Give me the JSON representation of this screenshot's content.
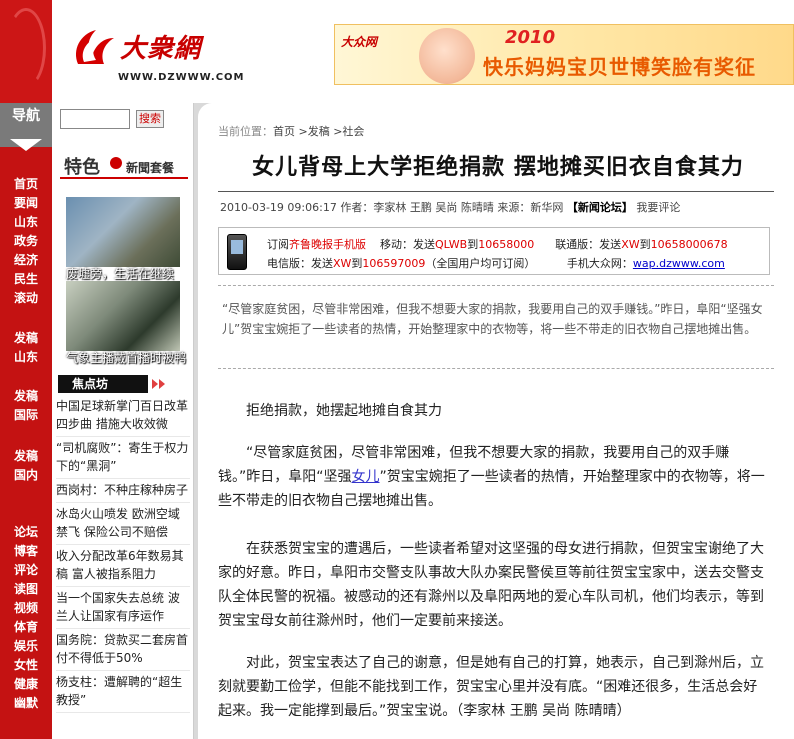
{
  "logo": {
    "name": "大衆網",
    "url": "WWW.DZWWW.COM"
  },
  "banner": {
    "logo": "大众网",
    "year": "2010",
    "slogan": "快乐妈妈宝贝世博笑脸有奖征"
  },
  "nav": {
    "header": "导航",
    "groups": [
      [
        "首页",
        "要闻",
        "山东",
        "政务",
        "经济",
        "民生",
        "滚动"
      ],
      [
        "发稿",
        "山东"
      ],
      [
        "发稿",
        "国际"
      ],
      [
        "发稿",
        "国内"
      ],
      [
        "论坛",
        "博客",
        "评论",
        "读图",
        "视频",
        "体育",
        "娱乐",
        "女性",
        "健康",
        "幽默"
      ]
    ]
  },
  "sidebar": {
    "search_button": "搜索",
    "tese": {
      "big": "特色",
      "small": "新聞套餐"
    },
    "captions": [
      "废墟旁，生活在继续",
      "气象主播戴首播时被鸭"
    ],
    "jiaodian_title": "焦点坊",
    "jiaodian": [
      "中国足球新掌门百日改革四步曲 措施大收效微",
      "“司机腐败”：寄生于权力下的“黑洞”",
      "西岗村：不种庄稼种房子",
      "冰岛火山喷发 欧洲空域禁飞 保险公司不赔偿",
      "收入分配改革6年数易其稿 富人被指系阻力",
      "当一个国家失去总统 波兰人让国家有序运作",
      "国务院：贷款买二套房首付不得低于50%",
      "杨支柱：遭解聘的“超生教授”"
    ]
  },
  "article": {
    "crumb_label": "当前位置：",
    "crumb_path": "首页 >发稿 >社会",
    "title": "女儿背母上大学拒绝捐款  摆地摊买旧衣自食其力",
    "meta_date": "2010-03-19 09:06:17",
    "meta_author": "作者：李家林 王鹏 吴尚 陈晴晴",
    "meta_source": "来源：新华网",
    "meta_forum": "【新闻论坛】",
    "meta_comment": "我要评论",
    "promo": {
      "line1_a": "订阅",
      "line1_b": "齐鲁晚报手机版",
      "line1_c": "移动：发送",
      "line1_d": "QLWB",
      "line1_e": "到",
      "line1_f": "10658000",
      "line1_g": "联通版：发送",
      "line1_h": "XW",
      "line1_i": "到",
      "line1_j": "10658000678",
      "line2_a": "电信版：发送",
      "line2_b": "XW",
      "line2_c": "到",
      "line2_d": "106597009",
      "line2_e": "（全国用户均可订阅）",
      "line2_f": "手机大众网：",
      "line2_g": "wap.dzwww.com"
    },
    "summary": "“尽管家庭贫困，尽管非常困难，但我不想要大家的捐款，我要用自己的双手赚钱。”昨日，阜阳“坚强女儿”贺宝宝婉拒了一些读者的热情，开始整理家中的衣物等，将一些不带走的旧衣物自己摆地摊出售。",
    "subhead": "拒绝捐款，她摆起地摊自食其力",
    "p1_a": "“尽管家庭贫困，尽管非常困难，但我不想要大家的捐款，我要用自己的双手赚钱。”昨日，阜阳“坚强",
    "p1_link": "女儿",
    "p1_b": "”贺宝宝婉拒了一些读者的热情，开始整理家中的衣物等，将一些不带走的旧衣物自己摆地摊出售。",
    "p2": "在获悉贺宝宝的遭遇后，一些读者希望对这坚强的母女进行捐款，但贺宝宝谢绝了大家的好意。昨日，阜阳市交警支队事故大队办案民警侯亘等前往贺宝宝家中，送去交警支队全体民警的祝福。被感动的还有滁州以及阜阳两地的爱心车队司机，他们均表示，等到贺宝宝母女前往滁州时，他们一定要前来接送。",
    "p3": "对此，贺宝宝表达了自己的谢意，但是她有自己的打算，她表示，自己到滁州后，立刻就要勤工俭学，但能不能找到工作，贺宝宝心里并没有底。“困难还很多，生活总会好起来。我一定能撑到最后。”贺宝宝说。（李家林 王鹏 吴尚 陈晴晴）"
  }
}
